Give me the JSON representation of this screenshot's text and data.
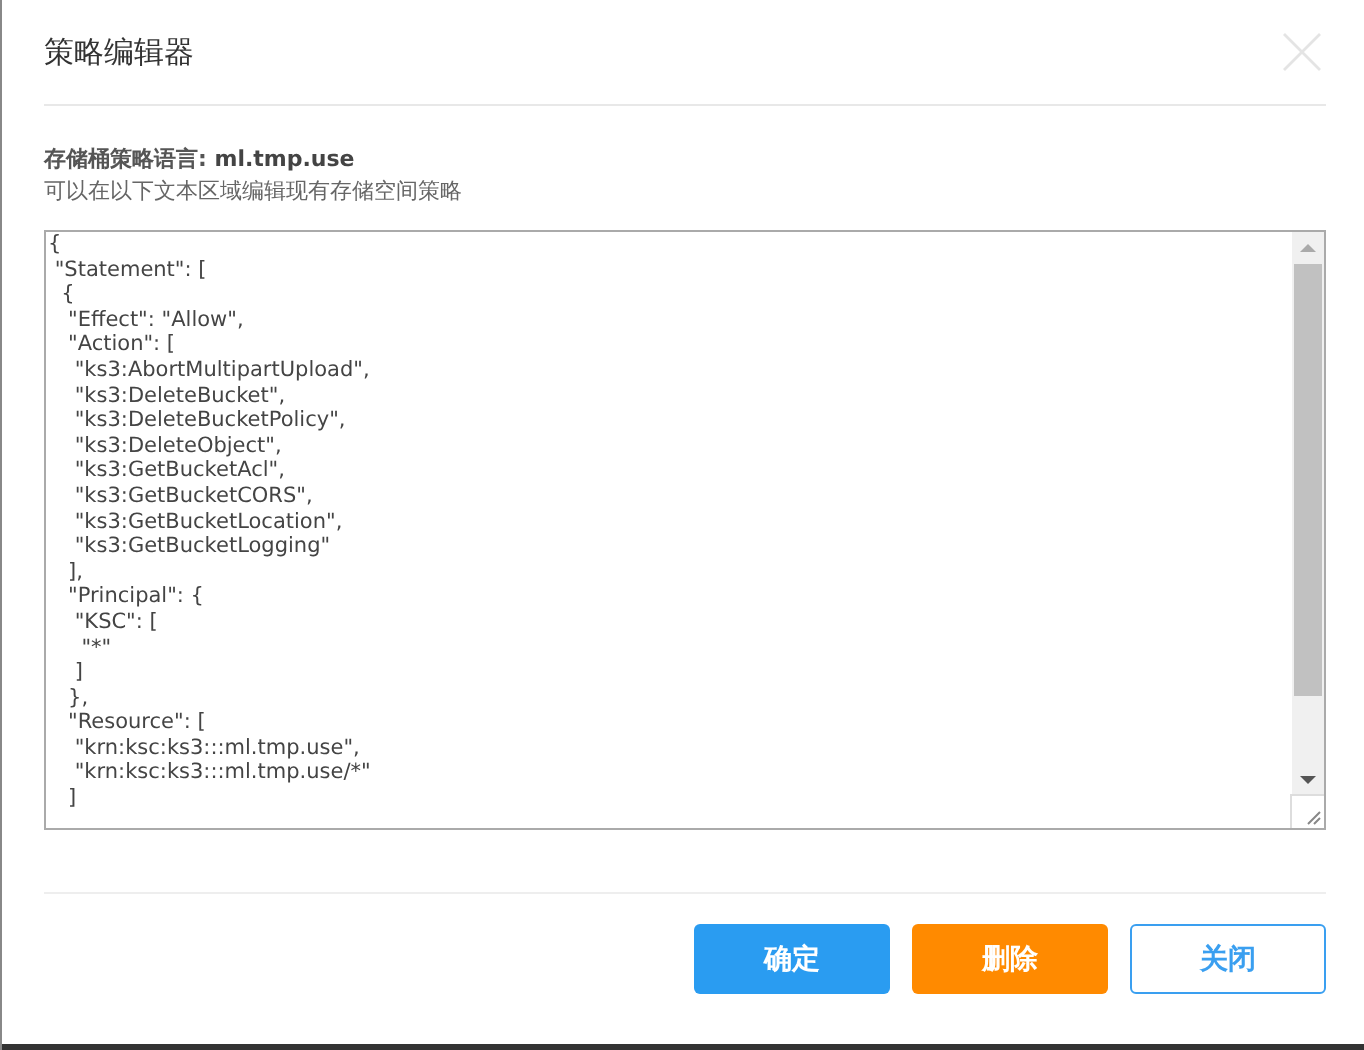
{
  "dialog": {
    "title": "策略编辑器"
  },
  "policy": {
    "label": "存储桶策略语言: ",
    "bucket": "ml.tmp.use",
    "hint": "可以在以下文本区域编辑现有存储空间策略"
  },
  "editor": {
    "value": "{\n \"Statement\": [\n  {\n   \"Effect\": \"Allow\",\n   \"Action\": [\n    \"ks3:AbortMultipartUpload\",\n    \"ks3:DeleteBucket\",\n    \"ks3:DeleteBucketPolicy\",\n    \"ks3:DeleteObject\",\n    \"ks3:GetBucketAcl\",\n    \"ks3:GetBucketCORS\",\n    \"ks3:GetBucketLocation\",\n    \"ks3:GetBucketLogging\"\n   ],\n   \"Principal\": {\n    \"KSC\": [\n     \"*\"\n    ]\n   },\n   \"Resource\": [\n    \"krn:ksc:ks3:::ml.tmp.use\",\n    \"krn:ksc:ks3:::ml.tmp.use/*\"\n   ]"
  },
  "buttons": [
    {
      "label": "确定",
      "kind": "primary"
    },
    {
      "label": "删除",
      "kind": "danger"
    },
    {
      "label": "关闭",
      "kind": "outline"
    }
  ]
}
